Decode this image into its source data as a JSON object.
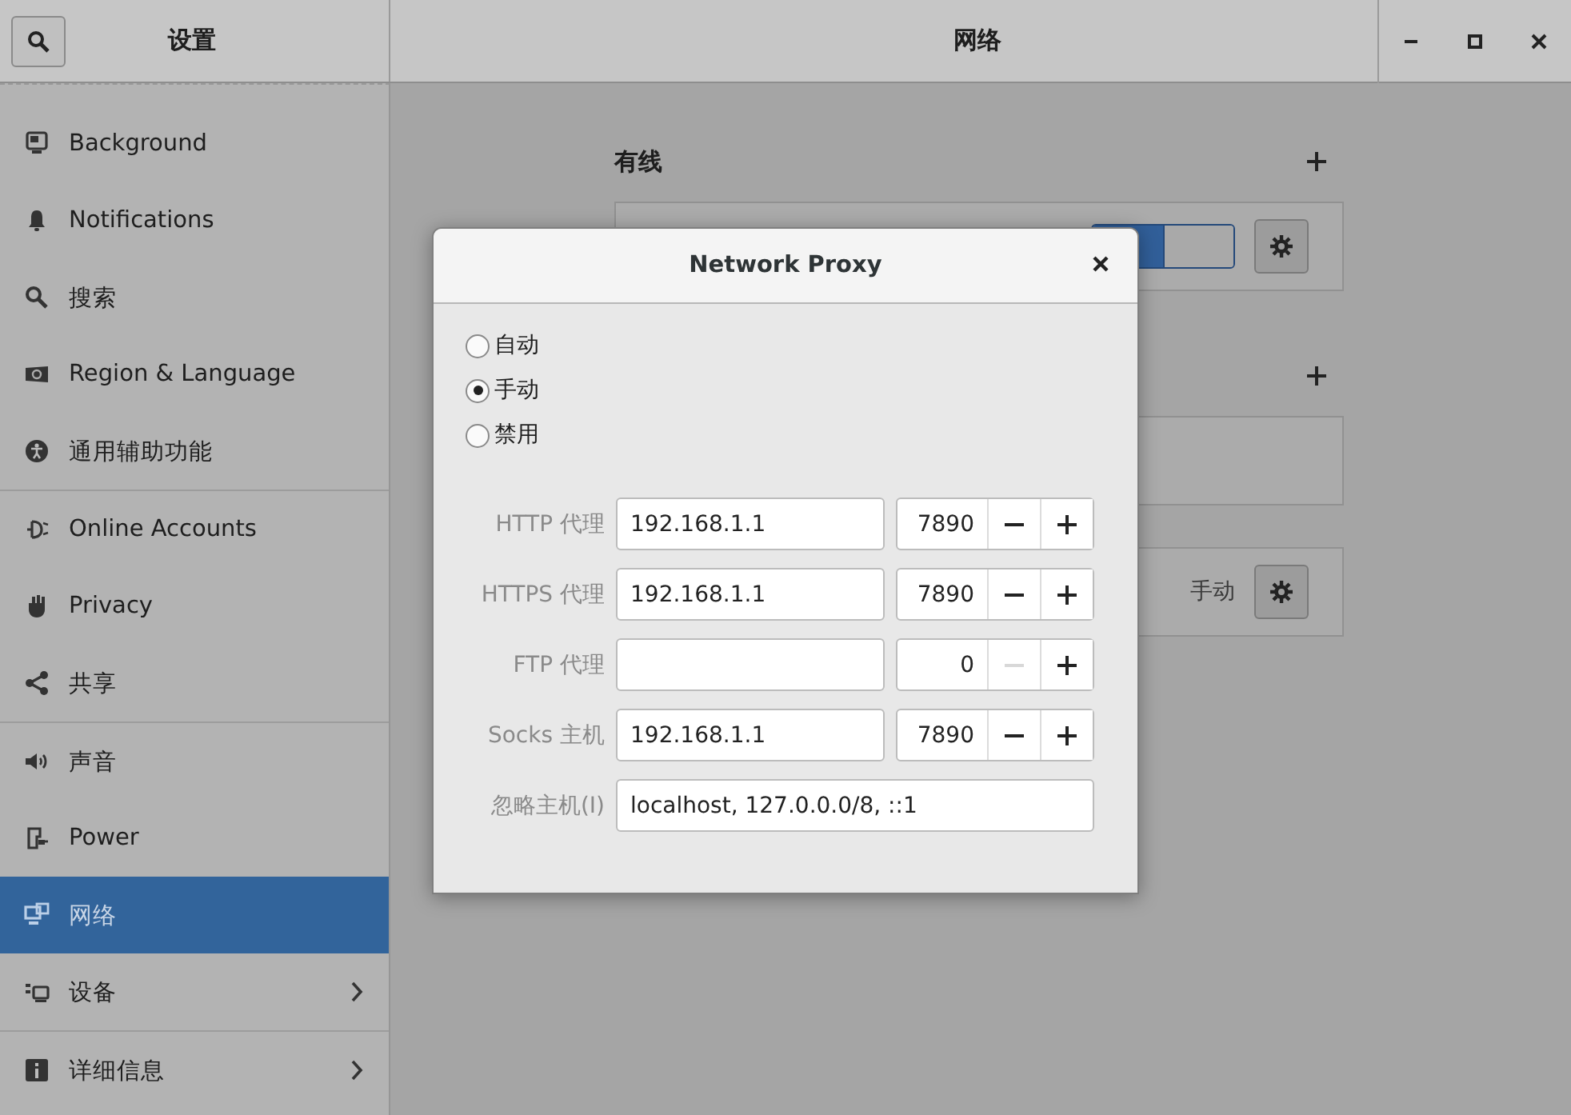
{
  "sidebar": {
    "title": "设置",
    "groups": [
      [
        {
          "label": "Background",
          "selected": false,
          "has_submenu": false
        },
        {
          "label": "Notifications",
          "selected": false,
          "has_submenu": false
        },
        {
          "label": "搜索",
          "selected": false,
          "has_submenu": false
        },
        {
          "label": "Region & Language",
          "selected": false,
          "has_submenu": false
        },
        {
          "label": "通用辅助功能",
          "selected": false,
          "has_submenu": false
        }
      ],
      [
        {
          "label": "Online Accounts",
          "selected": false,
          "has_submenu": false
        },
        {
          "label": "Privacy",
          "selected": false,
          "has_submenu": false
        },
        {
          "label": "共享",
          "selected": false,
          "has_submenu": false
        }
      ],
      [
        {
          "label": "声音",
          "selected": false,
          "has_submenu": false
        },
        {
          "label": "Power",
          "selected": false,
          "has_submenu": false
        },
        {
          "label": "网络",
          "selected": true,
          "has_submenu": false
        },
        {
          "label": "设备",
          "selected": false,
          "has_submenu": true
        }
      ],
      [
        {
          "label": "详细信息",
          "selected": false,
          "has_submenu": true
        }
      ]
    ]
  },
  "window": {
    "title": "网络"
  },
  "sections": [
    {
      "heading": "有线",
      "cards": [
        {
          "kind": "switch",
          "on": true
        }
      ]
    },
    {
      "cards": [
        {
          "kind": "empty"
        },
        {
          "kind": "value",
          "value": "手动"
        }
      ]
    }
  ],
  "dialog": {
    "title": "Network Proxy",
    "modes": [
      {
        "label": "自动",
        "selected": false
      },
      {
        "label": "手动",
        "selected": true
      },
      {
        "label": "禁用",
        "selected": false
      }
    ],
    "proxies": [
      {
        "label": "HTTP 代理",
        "host": "192.168.1.1",
        "port": "7890",
        "minus_disabled": false
      },
      {
        "label": "HTTPS 代理",
        "host": "192.168.1.1",
        "port": "7890",
        "minus_disabled": false
      },
      {
        "label": "FTP 代理",
        "port": "0",
        "minus_disabled": true
      },
      {
        "label": "Socks 主机",
        "host": "192.168.1.1",
        "port": "7890",
        "minus_disabled": false
      }
    ],
    "ignore": {
      "label": "忽略主机(I)",
      "value": "localhost, 127.0.0.0/8, ::1"
    }
  }
}
